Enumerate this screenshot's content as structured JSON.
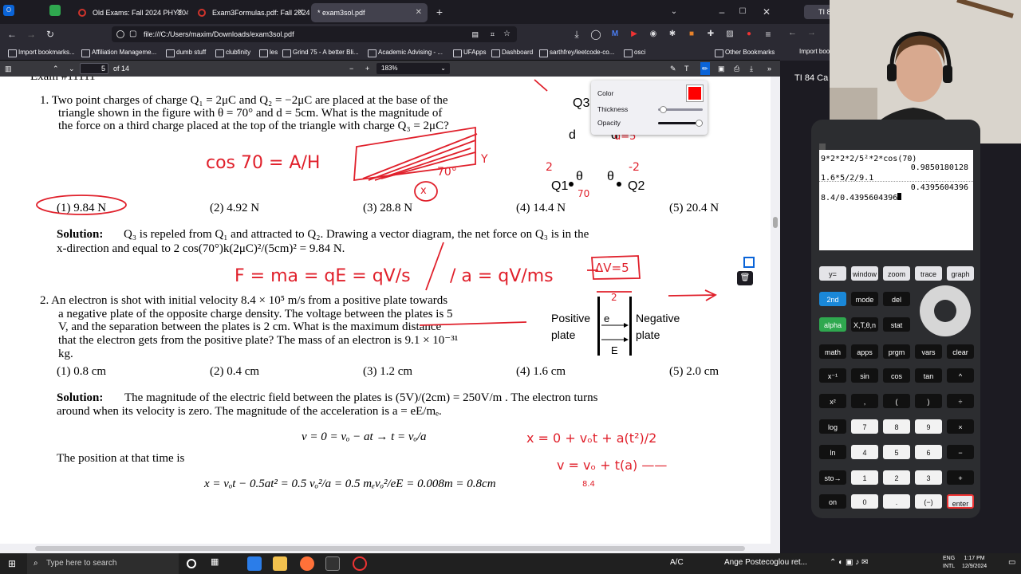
{
  "tabs": [
    {
      "label": "Old Exams: Fall 2024 PHY2049"
    },
    {
      "label": "Exam3Formulas.pdf: Fall 2024 F"
    },
    {
      "label": "* exam3sol.pdf"
    }
  ],
  "url": "file:///C:/Users/maxim/Downloads/exam3sol.pdf",
  "bookmarks": [
    "Import bookmarks...",
    "Affiliation Manageme...",
    "dumb stuff",
    "clubfinity",
    "les",
    "Grind 75 - A better Bli...",
    "Academic Advising - ...",
    "UFApps",
    "Dashboard",
    "sarthfrey/leetcode-co...",
    "osci",
    "Other Bookmarks"
  ],
  "pdf": {
    "page": "5",
    "page_count": "of 14",
    "zoom": "183%"
  },
  "annotation_popup": {
    "color_label": "Color",
    "color": "#ff0000",
    "thickness_label": "Thickness",
    "opacity_label": "Opacity",
    "thickness": 0.05,
    "opacity": 1.0
  },
  "doc": {
    "header": "Exam #11111",
    "q1": {
      "lines": [
        "1.  Two point charges of charge Q₁ = 2μC and Q₂ = −2μC are placed at the base of the",
        "triangle shown in the figure with θ = 70° and d = 5cm. What is the magnitude of",
        "the force on a third charge placed at the top of the triangle with charge Q₃ = 2μC?"
      ],
      "choices": [
        "(1) 9.84 N",
        "(2) 4.92 N",
        "(3) 28.8 N",
        "(4) 14.4 N",
        "(5) 20.4 N"
      ],
      "solution_label": "Solution:",
      "solution": [
        "Q₃ is repeled from Q₁ and attracted to Q₂. Drawing a vector diagram, the net force on Q₃ is in the",
        "x-direction and equal to 2 cos(70°)k(2μC)²/(5cm)² = 9.84 N."
      ],
      "figure": {
        "q3": "Q3",
        "d_left": "d",
        "d_right": "d",
        "theta_left": "θ",
        "theta_right": "θ",
        "q1": "Q1",
        "q2": "Q2"
      }
    },
    "q2": {
      "lines": [
        "2.  An electron is shot with initial velocity 8.4 × 10⁵ m/s from a positive plate towards",
        "a negative plate of the opposite charge density. The voltage between the plates is 5",
        "V, and the separation between the plates is 2 cm. What is the maximum distance",
        "that the electron gets from the positive plate? The mass of an electron is 9.1 × 10⁻³¹",
        "kg."
      ],
      "choices": [
        "(1) 0.8 cm",
        "(2) 0.4 cm",
        "(3) 1.2 cm",
        "(4) 1.6 cm",
        "(5) 2.0 cm"
      ],
      "solution_label": "Solution:",
      "solution": [
        "The magnitude of the electric field between the plates is (5V)/(2cm) = 250V/m . The electron turns",
        "around when its velocity is zero. The magnitude of the acceleration is a = eE/mₑ."
      ],
      "eq1": "v = 0 = vₒ − at → t = vₒ/a",
      "position_text": "The position at that time is",
      "eq2": "x = vₒt − 0.5at² = 0.5 vₒ²/a = 0.5 mₑvₒ²/eE = 0.008m = 0.8cm",
      "figure": {
        "pos": "Positive",
        "pos2": "plate",
        "neg": "Negative",
        "neg2": "plate",
        "e": "e",
        "E": "E"
      }
    },
    "ink": {
      "cos": "cos 70 = A/H",
      "cos_a": "A",
      "cos_h": "H",
      "tri_70": "70°",
      "tri_x": "x",
      "tri_y": "Y",
      "fig_2l": "2",
      "fig_2r": "-2",
      "fig_70": "70",
      "fig_ds": "d=5",
      "force": "F = ma = qE = qV/s",
      "force_a": "/ a = qV/ms",
      "dv": "ΔV=5",
      "dim2": "2",
      "kin1": "x = 0 + vₒt + a(t²)/2",
      "kin2": "v = vₒ + t(a) ——",
      "kin3": "8.4"
    }
  },
  "right_browser": {
    "tab": "TI 8",
    "title": "TI 84 Ca",
    "bookmarks": "Import book"
  },
  "calculator": {
    "lines": [
      {
        "expr": "9*2*2*2/5²*2*cos(70)",
        "result": "0.9850180128"
      },
      {
        "expr": "1.6*5/2/9.1",
        "result": "0.4395604396"
      },
      {
        "expr": "8.4/0.4395604396",
        "result": ""
      }
    ],
    "keys": [
      [
        "y=",
        "window",
        "zoom",
        "trace",
        "graph"
      ],
      [
        "2nd",
        "mode",
        "del"
      ],
      [
        "alpha",
        "X,T,θ,n",
        "stat"
      ],
      [
        "math",
        "apps",
        "prgm",
        "vars",
        "clear"
      ],
      [
        "x⁻¹",
        "sin",
        "cos",
        "tan",
        "^"
      ],
      [
        "x²",
        ",",
        "(",
        ")",
        "÷"
      ],
      [
        "log",
        "7",
        "8",
        "9",
        "×"
      ],
      [
        "ln",
        "4",
        "5",
        "6",
        "−"
      ],
      [
        "sto→",
        "1",
        "2",
        "3",
        "+"
      ],
      [
        "on",
        "0",
        ".",
        "(−)",
        "enter"
      ]
    ]
  },
  "taskbar": {
    "search": "Type here to search",
    "news": "A/C",
    "weather": "Ange Postecoglou ret...",
    "lang1": "ENG",
    "lang2": "INTL",
    "time": "1:17 PM",
    "date": "12/9/2024"
  }
}
